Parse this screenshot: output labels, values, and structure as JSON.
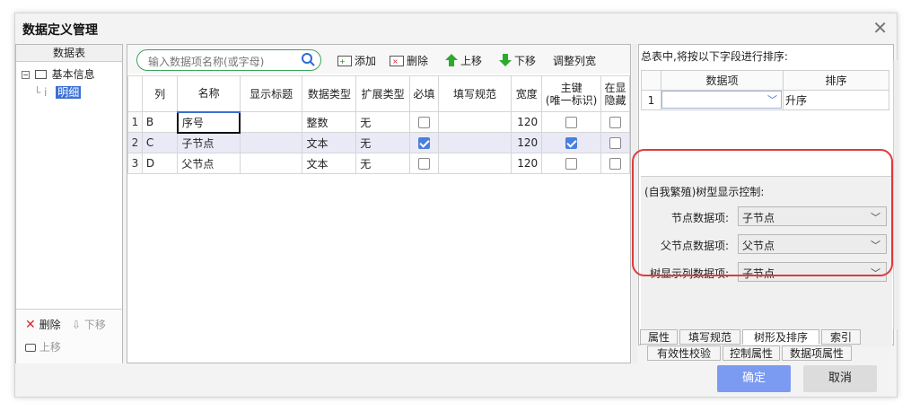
{
  "dialog": {
    "title": "数据定义管理"
  },
  "tree": {
    "header": "数据表",
    "root": "基本信息",
    "child": "明细",
    "actions": {
      "delete": "删除",
      "move_down": "下移",
      "move_up": "上移"
    }
  },
  "toolbar": {
    "search_placeholder": "输入数据项名称(或字母)",
    "add": "添加",
    "delete": "删除",
    "move_up": "上移",
    "move_down": "下移",
    "adjust_width": "调整列宽"
  },
  "grid": {
    "columns": [
      "列",
      "名称",
      "显示标题",
      "数据类型",
      "扩展类型",
      "必填",
      "填写规范",
      "宽度",
      "主键",
      "(唯一标识)",
      "在显",
      "隐藏"
    ],
    "rows": [
      {
        "num": "1",
        "col": "B",
        "name": "序号",
        "title": "",
        "type": "整数",
        "ext": "无",
        "required": false,
        "rule": "",
        "width": "120",
        "pk": false
      },
      {
        "num": "2",
        "col": "C",
        "name": "子节点",
        "title": "",
        "type": "文本",
        "ext": "无",
        "required": true,
        "rule": "",
        "width": "120",
        "pk": true
      },
      {
        "num": "3",
        "col": "D",
        "name": "父节点",
        "title": "",
        "type": "文本",
        "ext": "无",
        "required": false,
        "rule": "",
        "width": "120",
        "pk": false
      }
    ]
  },
  "sort": {
    "title": "总表中,将按以下字段进行排序:",
    "col_item": "数据项",
    "col_order": "排序",
    "row_num": "1",
    "order_value": "升序"
  },
  "tree_display": {
    "title": "(自我繁殖)树型显示控制:",
    "node_label": "节点数据项:",
    "node_value": "子节点",
    "parent_label": "父节点数据项:",
    "parent_value": "父节点",
    "display_label": "树显示列数据项:",
    "display_value": "子节点"
  },
  "tabs": {
    "row1": [
      "属性",
      "填写规范",
      "树形及排序",
      "索引"
    ],
    "row2": [
      "有效性校验",
      "控制属性",
      "数据项属性"
    ]
  },
  "buttons": {
    "ok": "确定",
    "cancel": "取消"
  },
  "colors": {
    "accent": "#7b9bf2",
    "highlight": "#e0393e",
    "search_border": "#3aa55d",
    "checkbox_on": "#4a7fe0"
  }
}
